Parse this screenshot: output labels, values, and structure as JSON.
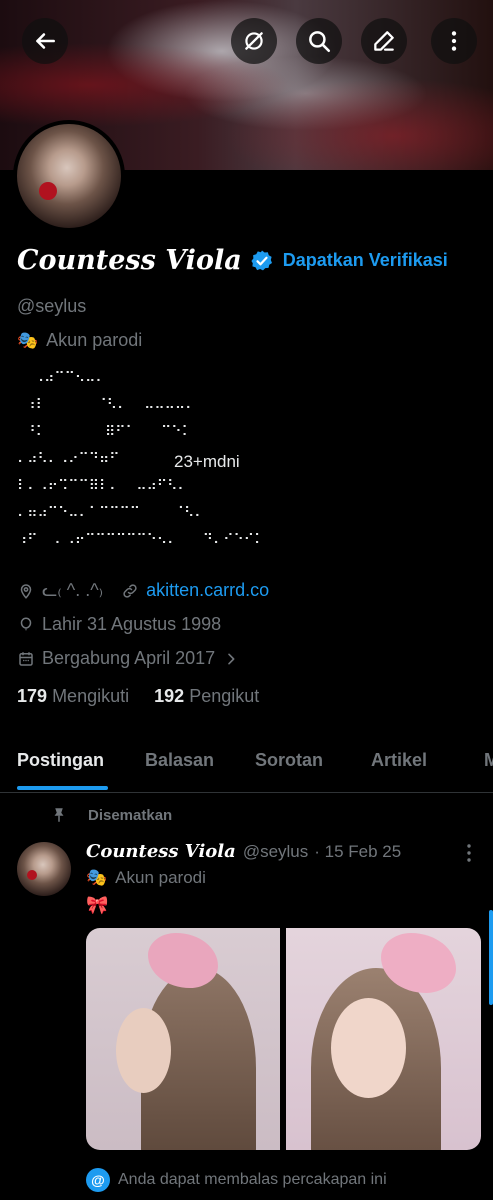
{
  "profile": {
    "display_name": "Countess Viola",
    "verify_cta": "Dapatkan Verifikasi",
    "handle": "@seylus",
    "parody_label": "Akun parodi",
    "bio_ascii": "  ⠠⠴⠉⠉⠢⠤⠄\n ⠰⠇      ⠈⠣⠄  ⠤⠤⠤⠤⠄\n ⠘⠅       ⠿⠋⠁   ⠉⠑⠅\n⠄⠴⠣⠄⠠⠔⠉⠙⠶⠋\n⠇⠄⠠⠖⠩⠉⠉⠿⠇⠄  ⠤⠴⠋⠣⠄\n⠄⠶⠴⠉⠑⠤⠄⠁⠉⠉⠉⠉    ⠈⠣⠄\n⠰⠋  ⠄⠠⠖⠉⠉⠉⠉⠉⠉⠑⠢⠄   ⠙⠄⠊⠑⠊⠅",
    "bio_tag": "23+mdni",
    "location": "ᓚ₍ ^. .^₎",
    "website": "akitten.carrd.co",
    "birthday": "Lahir 31 Agustus 1998",
    "joined": "Bergabung April 2017",
    "following_count": "179",
    "following_label": "Mengikuti",
    "followers_count": "192",
    "followers_label": "Pengikut"
  },
  "tabs": [
    "Postingan",
    "Balasan",
    "Sorotan",
    "Artikel",
    "M"
  ],
  "pinned_post": {
    "pinned_label": "Disematkan",
    "author_name": "Countess Viola",
    "author_handle": "@seylus",
    "date": "· 15 Feb 25",
    "parody_label": "Akun parodi",
    "text": "🎀",
    "reply_note": "Anda dapat membalas percakapan ini",
    "reply_icon_text": "@"
  },
  "colors": {
    "accent": "#1d9bf0",
    "muted": "#71767b",
    "text": "#e7e9ea",
    "background": "#000000"
  },
  "icons": [
    "back-arrow-icon",
    "grok-icon",
    "search-icon",
    "edit-icon",
    "more-vertical-icon",
    "verified-badge-icon",
    "mask-icon",
    "location-icon",
    "link-icon",
    "balloon-icon",
    "calendar-icon",
    "chevron-right-icon",
    "pin-icon"
  ]
}
